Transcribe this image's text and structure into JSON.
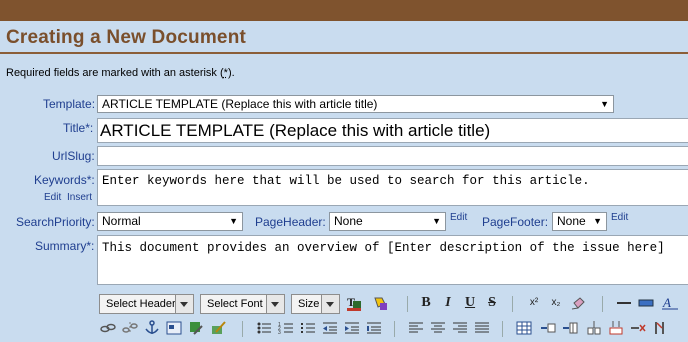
{
  "page": {
    "title": "Creating a New Document",
    "required_note_prefix": "Required fields are marked with an asterisk (",
    "required_note_asterisk": "*",
    "required_note_suffix": ")."
  },
  "form": {
    "template": {
      "label": "Template:",
      "value": "ARTICLE TEMPLATE (Replace this with article title)"
    },
    "title": {
      "label": "Title",
      "asterisk": "*",
      "colon": ":",
      "value": "ARTICLE TEMPLATE (Replace this with article title)"
    },
    "urlslug": {
      "label": "UrlSlug:",
      "value": ""
    },
    "keywords": {
      "label": "Keywords",
      "asterisk": "*",
      "colon": ":",
      "value": "Enter keywords here that will be used to search for this article.",
      "edit_link": "Edit",
      "insert_link": "Insert"
    },
    "search_priority": {
      "label": "SearchPriority:",
      "value": "Normal"
    },
    "page_header": {
      "label": "PageHeader:",
      "value": "None",
      "edit_link": "Edit"
    },
    "page_footer": {
      "label": "PageFooter:",
      "value": "None",
      "edit_link": "Edit"
    },
    "summary": {
      "label": "Summary",
      "asterisk": "*",
      "colon": ":",
      "value": "This document provides an overview of [Enter description of the issue here]"
    }
  },
  "toolbar": {
    "header_select": "Select Header",
    "font_select": "Select Font",
    "size_select": "Size",
    "bold": "B",
    "italic": "I",
    "underline": "U",
    "strike": "S",
    "superscript": "x²",
    "subscript": "x₂"
  }
}
